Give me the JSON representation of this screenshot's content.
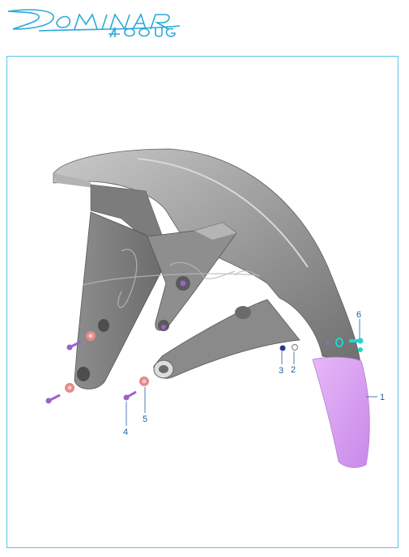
{
  "brand": {
    "line1": "DOMINAR",
    "line2": "400UG",
    "color": "#2aa9d8"
  },
  "watermark": {
    "style": "signature",
    "color": "#b9b9b9"
  },
  "callouts": [
    {
      "id": "1",
      "label": "1"
    },
    {
      "id": "2",
      "label": "2"
    },
    {
      "id": "3",
      "label": "3"
    },
    {
      "id": "4",
      "label": "4"
    },
    {
      "id": "5",
      "label": "5"
    },
    {
      "id": "6",
      "label": "6"
    }
  ],
  "colors": {
    "fender": "#8c8c8c",
    "mudflap": "#d79cf0",
    "bolt": "#9a63c9",
    "washer": "#e48a8a",
    "clip": "#1fd6d0",
    "frame": "#5bc6e6"
  }
}
